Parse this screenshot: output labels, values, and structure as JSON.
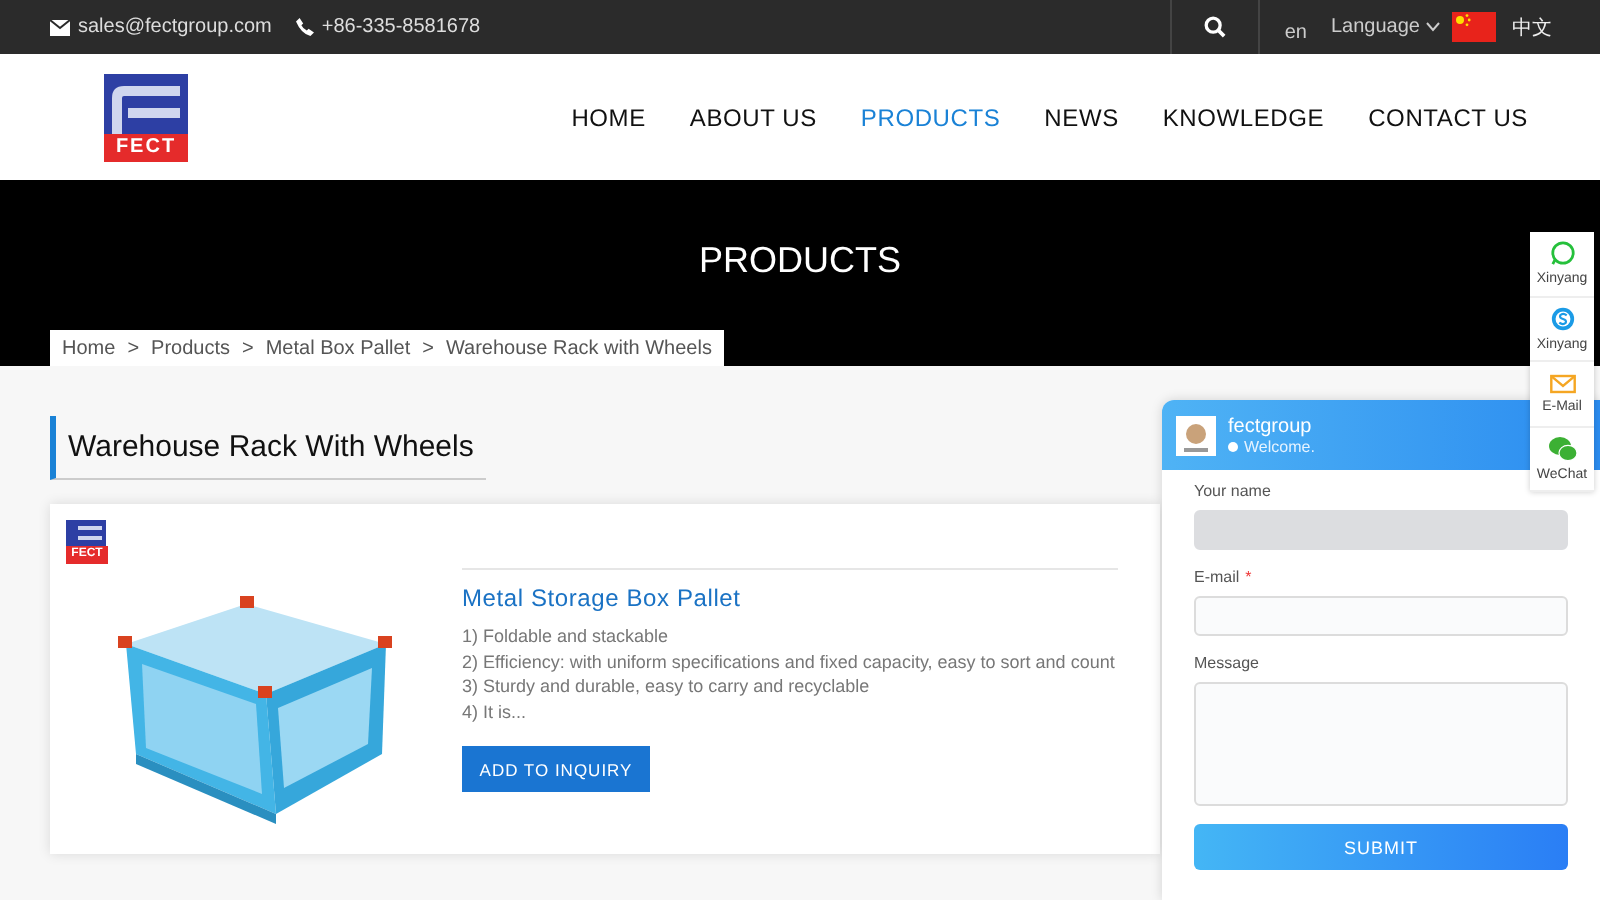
{
  "topbar": {
    "email": "sales@fectgroup.com",
    "phone": "+86-335-8581678",
    "lang_code": "en",
    "language": "Language",
    "lang_native": "中文"
  },
  "logo": {
    "text": "FECT"
  },
  "nav": [
    {
      "label": "HOME",
      "selected": false
    },
    {
      "label": "ABOUT US",
      "selected": false
    },
    {
      "label": "PRODUCTS",
      "selected": true
    },
    {
      "label": "NEWS",
      "selected": false
    },
    {
      "label": "KNOWLEDGE",
      "selected": false
    },
    {
      "label": "CONTACT US",
      "selected": false
    }
  ],
  "banner": {
    "title": "PRODUCTS"
  },
  "breadcrumb": {
    "separator": ">",
    "items": [
      "Home",
      "Products",
      "Metal Box Pallet",
      "Warehouse Rack with Wheels"
    ]
  },
  "section_title": "Warehouse Rack With Wheels",
  "product": {
    "badge_text": "FECT",
    "name": "Metal Storage Box Pallet",
    "features": [
      "1) Foldable and stackable",
      "2) Efficiency: with uniform specifications and fixed capacity, easy to sort and count",
      "3) Sturdy and durable, easy to carry and recyclable",
      "4) It is..."
    ],
    "button": "ADD TO INQUIRY"
  },
  "chat": {
    "name": "fectgroup",
    "status": "Welcome.",
    "online": true,
    "required_mark": "*",
    "fields": [
      {
        "label": "Your name",
        "kind": "input",
        "required": false,
        "highlighted": true
      },
      {
        "label": "E-mail",
        "kind": "input",
        "required": true,
        "highlighted": false
      },
      {
        "label": "Message",
        "kind": "textarea",
        "required": false,
        "highlighted": false
      }
    ],
    "submit": "SUBMIT"
  },
  "contacts": [
    {
      "kind": "whatsapp",
      "label": "Xinyang"
    },
    {
      "kind": "skype",
      "label": "Xinyang"
    },
    {
      "kind": "email",
      "label": "E-Mail"
    },
    {
      "kind": "wechat",
      "label": "WeChat"
    }
  ]
}
